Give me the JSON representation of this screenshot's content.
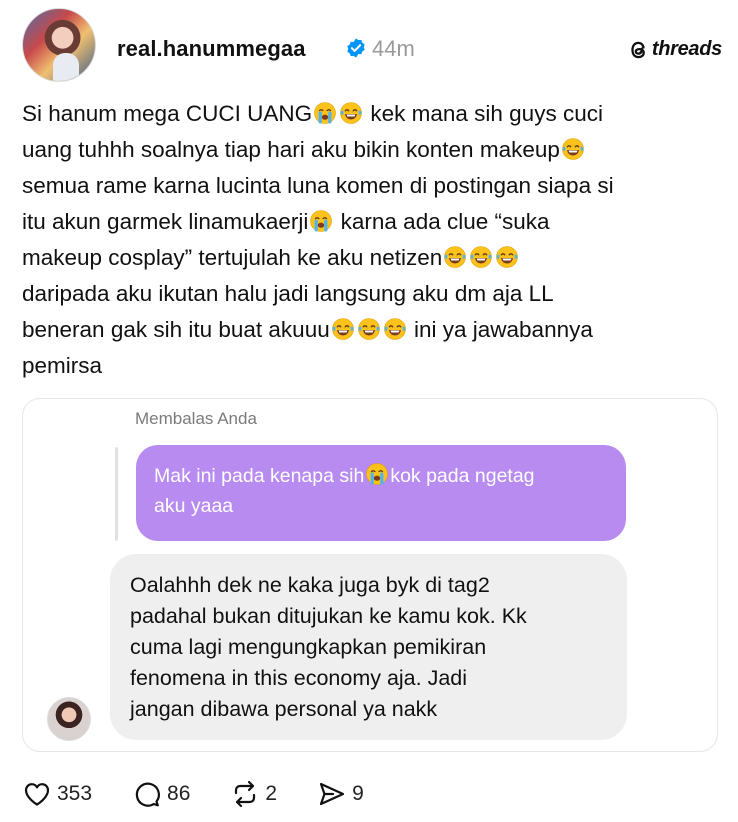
{
  "post": {
    "username": "real.hanummegaa",
    "time": "44m",
    "brand": "threads",
    "lines": [
      {
        "text": "Si hanum mega CUCI UANG",
        "emojis": [
          "loudly-crying-face",
          "face-with-tears-of-joy"
        ],
        "after": " kek mana sih guys cuci"
      },
      {
        "text": "uang tuhhh soalnya tiap hari aku bikin konten makeup",
        "emojis": [
          "face-with-tears-of-joy"
        ],
        "after": ""
      },
      {
        "text": "semua rame karna lucinta luna komen di postingan siapa si",
        "emojis": [],
        "after": ""
      },
      {
        "text": "itu akun garmek linamukaerji",
        "emojis": [
          "loudly-crying-face"
        ],
        "after": " karna ada clue “suka"
      },
      {
        "text": "makeup cosplay” tertujulah ke aku netizen",
        "emojis": [
          "face-with-tears-of-joy",
          "face-with-tears-of-joy",
          "face-with-tears-of-joy"
        ],
        "after": ""
      },
      {
        "text": "daripada aku ikutan halu jadi langsung aku dm aja LL",
        "emojis": [],
        "after": ""
      },
      {
        "text": "beneran gak sih itu buat akuuu",
        "emojis": [
          "face-with-tears-of-joy",
          "face-with-tears-of-joy",
          "face-with-tears-of-joy"
        ],
        "after": " ini ya jawabannya"
      },
      {
        "text": "pemirsa",
        "emojis": [],
        "after": ""
      }
    ]
  },
  "dm": {
    "reply_label": "Membalas Anda",
    "sent_lines": [
      {
        "text": "Mak ini pada kenapa sih",
        "emojis": [
          "loudly-crying-face"
        ],
        "after": "kok pada ngetag"
      },
      {
        "text": "aku yaaa",
        "emojis": [],
        "after": ""
      }
    ],
    "received_lines": [
      "Oalahhh dek ne kaka juga byk di tag2",
      "padahal bukan ditujukan ke kamu kok. Kk",
      "cuma lagi mengungkapkan pemikiran",
      "fenomena in this economy aja. Jadi",
      "jangan dibawa personal ya nakk"
    ]
  },
  "actions": {
    "likes": "353",
    "comments": "86",
    "reposts": "2",
    "shares": "9"
  },
  "colors": {
    "sent_bubble": "#b88bf0",
    "received_bubble": "#efefef",
    "verified_badge": "#0095f6",
    "muted_text": "#9a9a9a"
  },
  "icons": [
    "heart-icon",
    "comment-icon",
    "repost-icon",
    "share-icon",
    "verified-badge-icon",
    "threads-logo-icon"
  ]
}
